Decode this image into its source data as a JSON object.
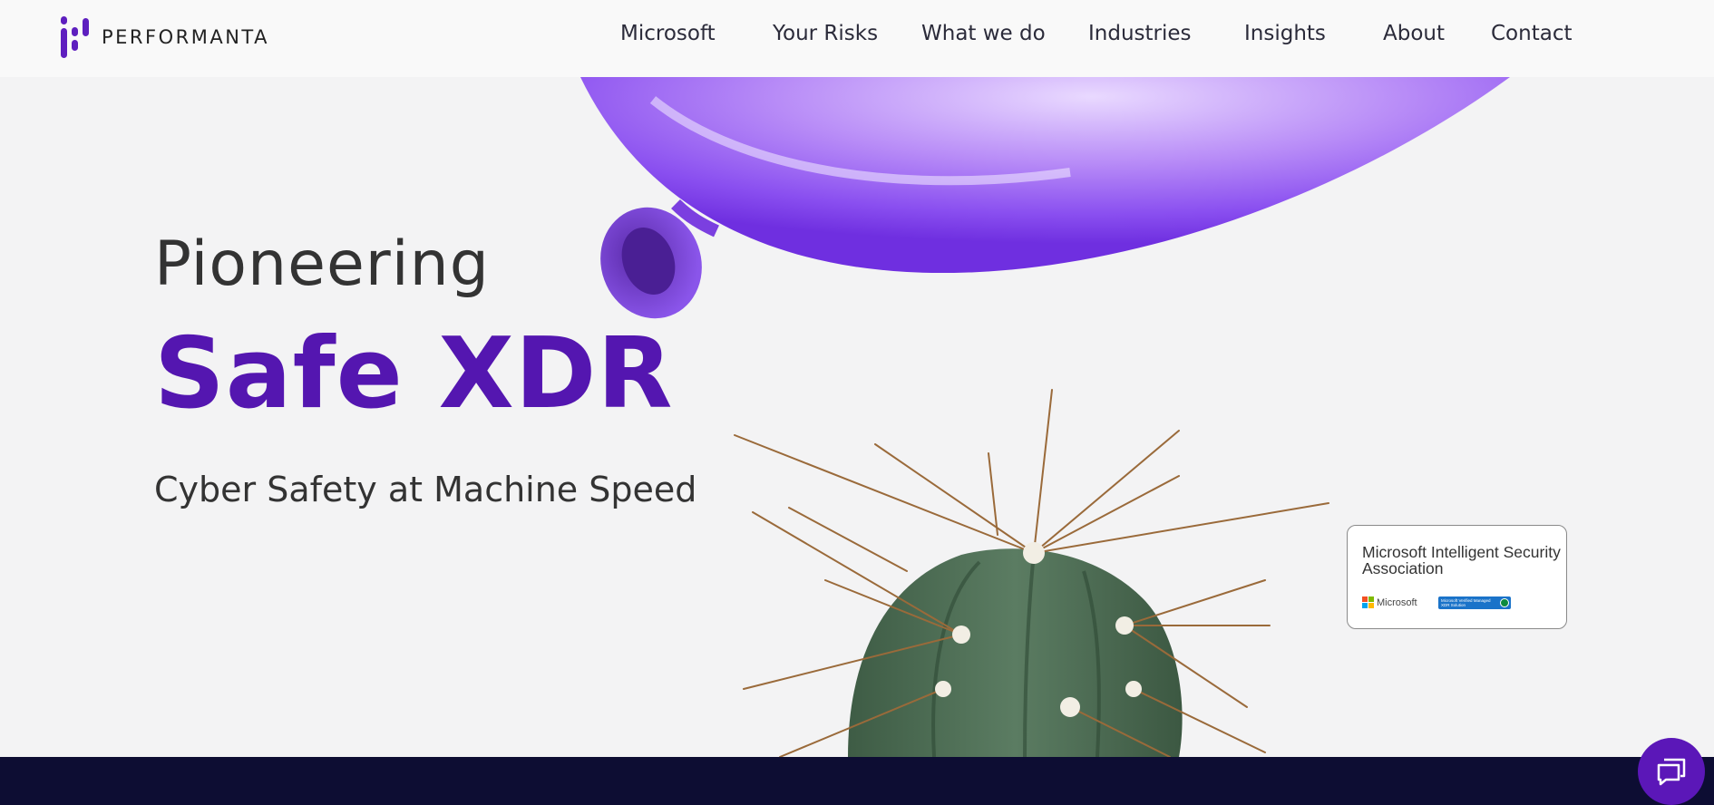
{
  "brand": {
    "name": "PERFORMANTA",
    "accent": "#5416b0"
  },
  "nav": {
    "items": [
      {
        "label": "Microsoft"
      },
      {
        "label": "Your Risks"
      },
      {
        "label": "What we do"
      },
      {
        "label": "Industries"
      },
      {
        "label": "Insights"
      },
      {
        "label": "About"
      },
      {
        "label": "Contact"
      }
    ]
  },
  "hero": {
    "pre_title": "Pioneering",
    "title": "Safe XDR",
    "subtitle": "Cyber Safety at Machine Speed"
  },
  "badge": {
    "title": "Microsoft Intelligent Security Association",
    "microsoft_label": "Microsoft",
    "verified_label": "Microsoft Verified Managed XDR Solution"
  },
  "chat": {
    "icon": "chat-icon"
  },
  "colors": {
    "background": "#f3f3f4",
    "footer": "#0d0d33",
    "balloon": "#8a4ff0",
    "cactus": "#4e6f55"
  }
}
